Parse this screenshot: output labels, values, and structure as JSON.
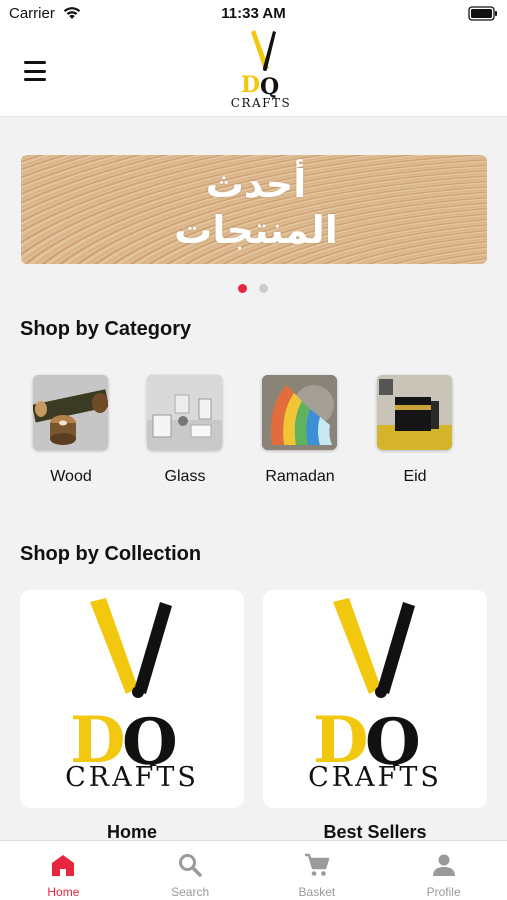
{
  "status_bar": {
    "carrier": "Carrier",
    "time": "11:33 AM"
  },
  "header": {
    "logo_text": "CRAFTS",
    "logo_letters": "DQ"
  },
  "banner": {
    "text_line1": "أحدث",
    "text_line2": "المنتجات",
    "slides": 2,
    "active_slide": 1
  },
  "categories": {
    "title": "Shop by Category",
    "items": [
      {
        "label": "Wood"
      },
      {
        "label": "Glass"
      },
      {
        "label": "Ramadan"
      },
      {
        "label": "Eid"
      }
    ]
  },
  "collections": {
    "title": "Shop by Collection",
    "items": [
      {
        "label": "Home",
        "logo_text": "CRAFTS"
      },
      {
        "label": "Best Sellers",
        "logo_text": "CRAFTS"
      }
    ]
  },
  "tabbar": {
    "tabs": [
      {
        "label": "Home",
        "icon": "home-icon",
        "active": true
      },
      {
        "label": "Search",
        "icon": "search-icon",
        "active": false
      },
      {
        "label": "Basket",
        "icon": "cart-icon",
        "active": false
      },
      {
        "label": "Profile",
        "icon": "person-icon",
        "active": false
      }
    ]
  },
  "colors": {
    "accent": "#e8253f",
    "brand_yellow": "#f2c80f",
    "inactive": "#9a9a9a"
  }
}
